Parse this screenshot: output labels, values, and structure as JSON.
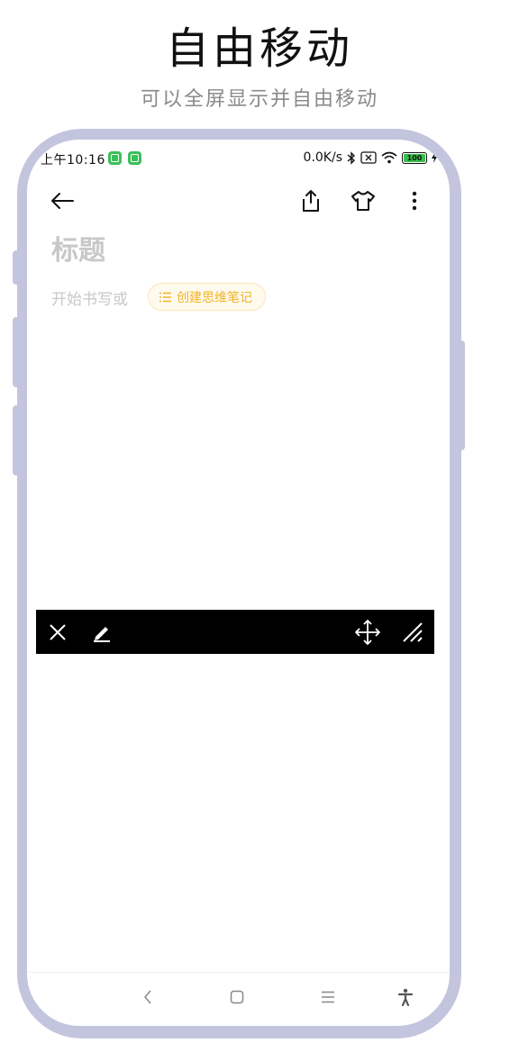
{
  "header": {
    "title": "自由移动",
    "subtitle": "可以全屏显示并自由移动"
  },
  "status_bar": {
    "time": "上午10:16",
    "net_speed": "0.0K/s",
    "battery": "100",
    "icons": [
      "notification-app-icon",
      "notification-app-icon",
      "bluetooth-icon",
      "sim-off-icon",
      "wifi-icon",
      "battery-icon",
      "charging-icon"
    ]
  },
  "toolbar": {
    "icons": [
      "back-arrow-icon",
      "share-icon",
      "shirt-theme-icon",
      "more-vertical-icon"
    ]
  },
  "note": {
    "title_placeholder": "标题",
    "body_placeholder": "开始书写或",
    "mindmap_button": "创建思维笔记",
    "accent_color": "#f0b52a"
  },
  "floating_bar": {
    "icons": [
      "close-icon",
      "pen-icon",
      "move-icon",
      "resize-icon"
    ],
    "background": "#000000"
  },
  "nav_bar": {
    "icons": [
      "nav-back-icon",
      "nav-home-icon",
      "nav-menu-icon",
      "accessibility-icon"
    ]
  },
  "frame_color": "#c3c5de"
}
